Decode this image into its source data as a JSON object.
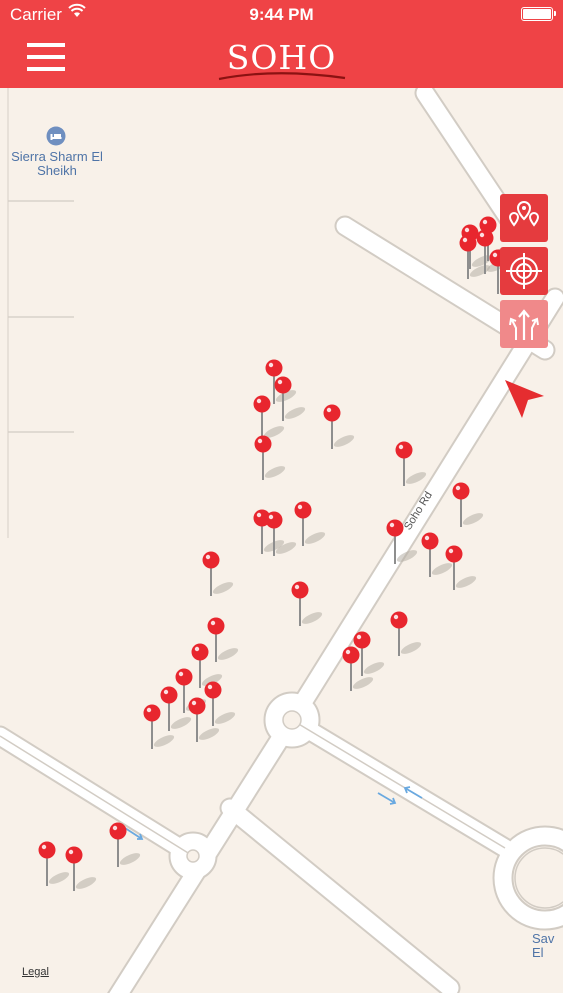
{
  "status_bar": {
    "carrier": "Carrier",
    "time": "9:44 PM"
  },
  "nav_bar": {
    "logo": "SOHO"
  },
  "map": {
    "poi": {
      "name": "Sierra Sharm El Sheikh",
      "icon": "bed-icon"
    },
    "road_name": "Soho Rd",
    "legal": "Legal",
    "partial_label": "Sav El",
    "pin_count": 39,
    "colors": {
      "pin": "#e8262e",
      "brand": "#ef4346",
      "map_bg": "#f8f1e9",
      "road": "#ffffff"
    }
  },
  "map_controls": [
    {
      "name": "show-all-pins",
      "icon": "map-pins-icon"
    },
    {
      "name": "locate-me",
      "icon": "crosshair-icon"
    },
    {
      "name": "directions",
      "icon": "directions-arrows-icon"
    }
  ]
}
